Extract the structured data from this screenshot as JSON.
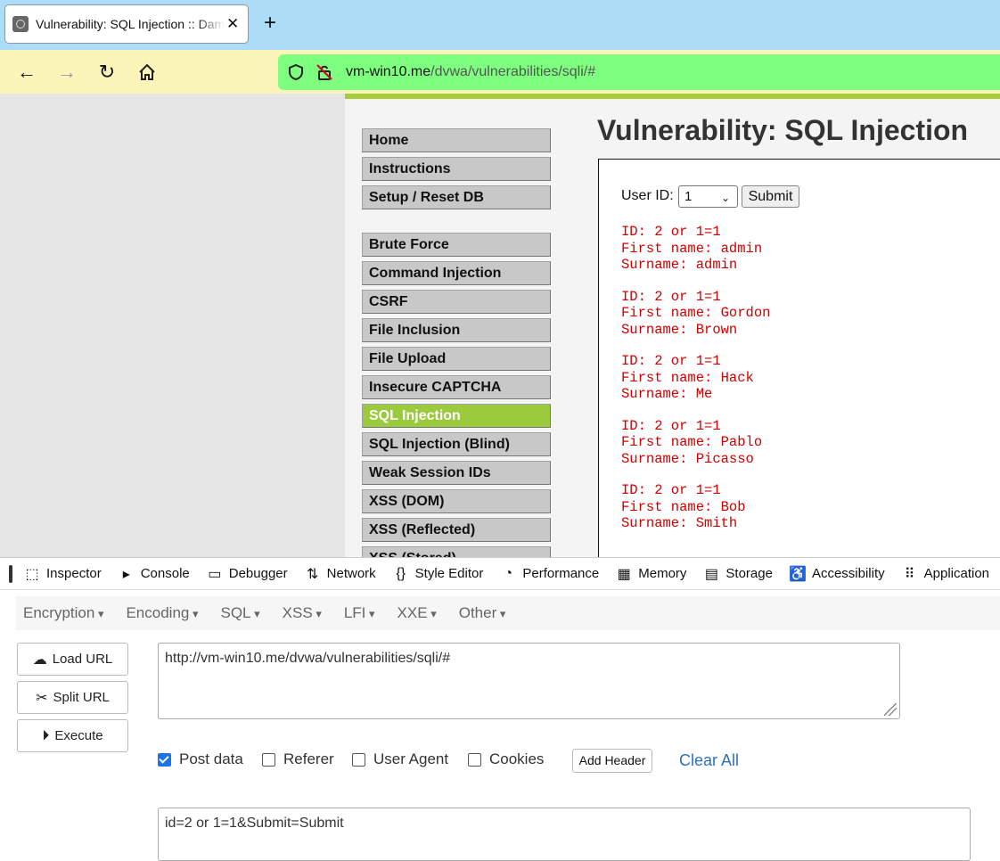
{
  "browser": {
    "tab_title": "Vulnerability: SQL Injection :: Damn Vulnerable Web Application",
    "url_host": "vm-win10.me",
    "url_path": "/dvwa/vulnerabilities/sqli/#"
  },
  "page": {
    "title": "Vulnerability: SQL Injection",
    "menu_top": [
      "Home",
      "Instructions",
      "Setup / Reset DB"
    ],
    "menu_vulns": [
      "Brute Force",
      "Command Injection",
      "CSRF",
      "File Inclusion",
      "File Upload",
      "Insecure CAPTCHA",
      "SQL Injection",
      "SQL Injection (Blind)",
      "Weak Session IDs",
      "XSS (DOM)",
      "XSS (Reflected)",
      "XSS (Stored)"
    ],
    "active_menu": "SQL Injection",
    "form": {
      "label": "User ID:",
      "selected": "1",
      "submit": "Submit"
    },
    "results": [
      {
        "id": "ID: 2 or 1=1",
        "first": "First name: admin",
        "last": "Surname: admin"
      },
      {
        "id": "ID: 2 or 1=1",
        "first": "First name: Gordon",
        "last": "Surname: Brown"
      },
      {
        "id": "ID: 2 or 1=1",
        "first": "First name: Hack",
        "last": "Surname: Me"
      },
      {
        "id": "ID: 2 or 1=1",
        "first": "First name: Pablo",
        "last": "Surname: Picasso"
      },
      {
        "id": "ID: 2 or 1=1",
        "first": "First name: Bob",
        "last": "Surname: Smith"
      }
    ],
    "colors": {
      "accent": "#a8cc38",
      "active_menu": "#9bca3d",
      "result_text": "#d20000"
    }
  },
  "devtools": {
    "tabs": [
      "Inspector",
      "Console",
      "Debugger",
      "Network",
      "Style Editor",
      "Performance",
      "Memory",
      "Storage",
      "Accessibility",
      "Application"
    ],
    "hackbar_menus": [
      "Encryption",
      "Encoding",
      "SQL",
      "XSS",
      "LFI",
      "XXE",
      "Other"
    ],
    "load_url": "Load URL",
    "split_url": "Split URL",
    "execute": "Execute",
    "url_value": "http://vm-win10.me/dvwa/vulnerabilities/sqli/#",
    "options": {
      "post_data": "Post data",
      "referer": "Referer",
      "user_agent": "User Agent",
      "cookies": "Cookies"
    },
    "add_header": "Add Header",
    "clear_all": "Clear All",
    "post_value": "id=2 or 1=1&Submit=Submit"
  }
}
